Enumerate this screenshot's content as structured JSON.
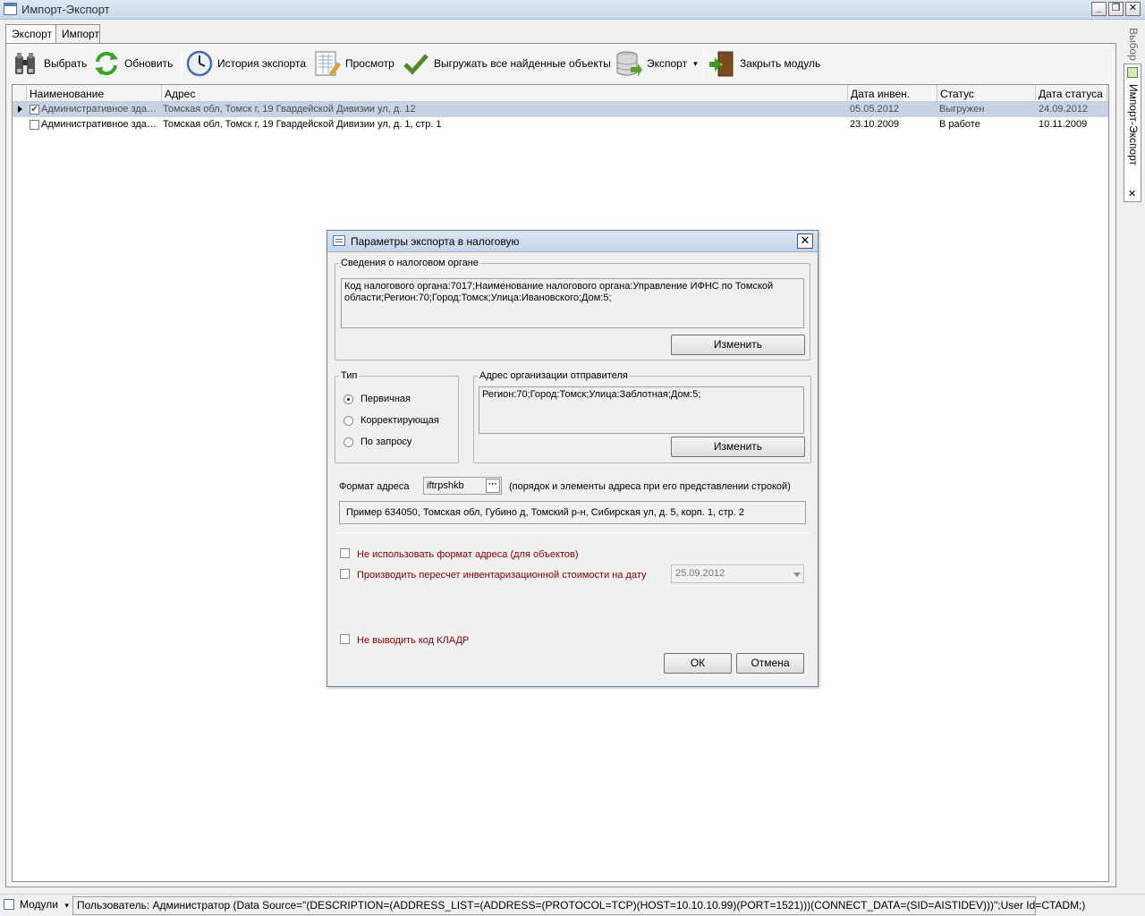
{
  "window": {
    "title": "Импорт-Экспорт",
    "minimize": "_",
    "restore": "❐",
    "close": "✕"
  },
  "tabs": [
    {
      "label": "Экспорт"
    },
    {
      "label": "Импорт"
    }
  ],
  "toolbar": {
    "select": "Выбрать",
    "refresh": "Обновить",
    "history": "История экспорта",
    "preview": "Просмотр",
    "export_all": "Выгружать все найденные объекты",
    "export": "Экспорт",
    "export_caret": "▾",
    "close_module": "Закрыть модуль"
  },
  "grid": {
    "columns": [
      "Наименование",
      "Адрес",
      "Дата инвен.",
      "Статус",
      "Дата статуса"
    ],
    "rows": [
      {
        "checked": "✔",
        "name": "Административное зда…",
        "address": "Томская обл, Томск г, 19 Гвардейской Дивизии ул, д. 12",
        "inv_date": "05.05.2012",
        "status": "Выгружен",
        "status_date": "24.09.2012",
        "selected": true
      },
      {
        "checked": "",
        "name": "Административное зда…",
        "address": "Томская обл, Томск г, 19 Гвардейской Дивизии ул, д. 1, стр. 1",
        "inv_date": "23.10.2009",
        "status": "В работе",
        "status_date": "10.11.2009",
        "selected": false
      }
    ]
  },
  "sidepanel": {
    "top_label": "Выбор",
    "tab_label": "Импорт-Экспорт",
    "close": "✕"
  },
  "statusbar": {
    "modules": "Модули",
    "modules_caret": "▾",
    "connection": "Пользователь: Администратор  (Data Source=\"(DESCRIPTION=(ADDRESS_LIST=(ADDRESS=(PROTOCOL=TCP)(HOST=10.10.10.99)(PORT=1521)))(CONNECT_DATA=(SID=AISTIDEV)))\";User Id=CTADM;)"
  },
  "dialog": {
    "title": "Параметры экспорта в налоговую",
    "close": "✕",
    "tax_group": {
      "legend": "Сведения о налоговом органе",
      "text": "Код налогового органа:7017;Наименование налогового органа:Управление ИФНС по Томской области;Регион:70;Город:Томск;Улица:Ивановского;Дом:5;",
      "change": "Изменить"
    },
    "type_group": {
      "legend": "Тип",
      "options": [
        {
          "label": "Первичная",
          "selected": true
        },
        {
          "label": "Корректирующая",
          "selected": false
        },
        {
          "label": "По запросу",
          "selected": false
        }
      ]
    },
    "sender_group": {
      "legend": "Адрес организации отправителя",
      "text": "Регион:70;Город:Томск;Улица:Заблотная;Дом:5;",
      "change": "Изменить"
    },
    "address_format": {
      "label": "Формат адреса",
      "value": "iftrpshkb",
      "browse": "···",
      "hint": "(порядок и элементы адреса при его представлении строкой)",
      "example": "Пример 634050, Томская обл, Губино д, Томский р-н, Сибирская ул, д. 5, корп. 1, стр. 2"
    },
    "options": {
      "no_address_format": "Не использовать формат адреса (для объектов)",
      "recalc": "Производить пересчет инвентаризационной стоимости на дату",
      "recalc_date": "25.09.2012",
      "no_kladr": "Не выводить код КЛАДР"
    },
    "ok": "ОК",
    "cancel": "Отмена"
  }
}
